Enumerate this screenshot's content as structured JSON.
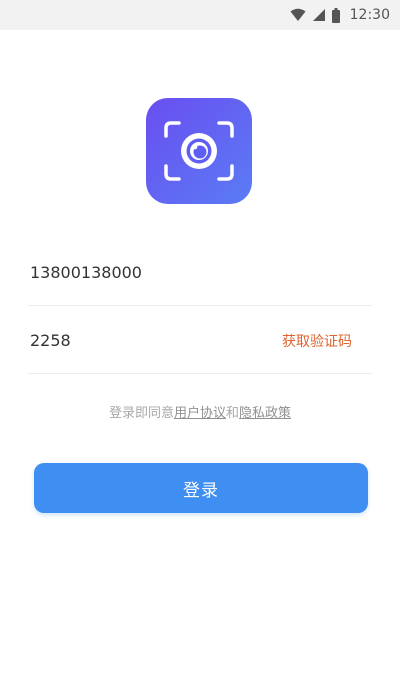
{
  "status_bar": {
    "time": "12:30",
    "icons": [
      "wifi-icon",
      "signal-icon",
      "battery-icon"
    ]
  },
  "logo": {
    "icon": "camera-scan-icon",
    "gradient_start": "#6a4ef0",
    "gradient_end": "#5a7cf5"
  },
  "form": {
    "phone_value": "13800138000",
    "code_value": "2258",
    "get_code_label": "获取验证码"
  },
  "agreement": {
    "prefix": "登录即同意",
    "user_agreement": "用户协议",
    "conjunction": "和",
    "privacy_policy": "隐私政策"
  },
  "login": {
    "label": "登录",
    "color": "#3f8ef1"
  },
  "colors": {
    "accent_orange": "#e0622c"
  }
}
